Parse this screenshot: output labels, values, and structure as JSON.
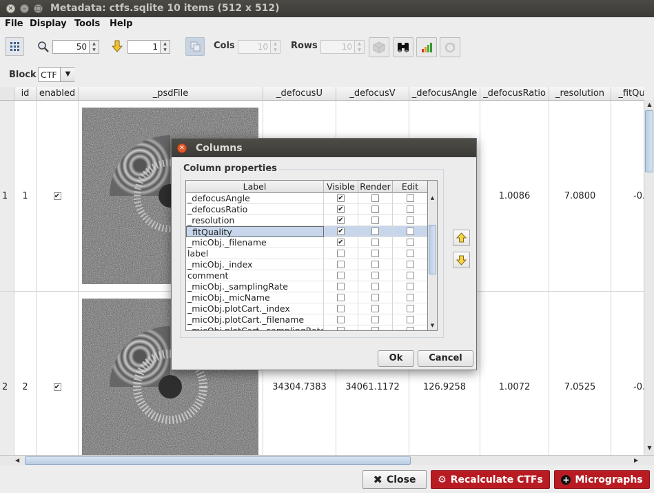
{
  "window": {
    "title": "Metadata: ctfs.sqlite 10 items (512 x 512)"
  },
  "menu": [
    "File",
    "Display",
    "Tools",
    "Help"
  ],
  "toolbar": {
    "zoom_value": "50",
    "goto_value": "1",
    "cols_label": "Cols",
    "cols_value": "10",
    "rows_label": "Rows",
    "rows_value": "10"
  },
  "block": {
    "label": "Block",
    "value": "CTF"
  },
  "table": {
    "headers": [
      "id",
      "enabled",
      "_psdFile",
      "_defocusU",
      "_defocusV",
      "_defocusAngle",
      "_defocusRatio",
      "_resolution",
      "_fitQu"
    ],
    "rows": [
      {
        "row": "1",
        "id": "1",
        "enabled": true,
        "defocusU": "",
        "defocusV": "",
        "defocusAngle": "",
        "defocusRatio": "1.0086",
        "resolution": "7.0800",
        "fitQu": "-0."
      },
      {
        "row": "2",
        "id": "2",
        "enabled": true,
        "defocusU": "34304.7383",
        "defocusV": "34061.1172",
        "defocusAngle": "126.9258",
        "defocusRatio": "1.0072",
        "resolution": "7.0525",
        "fitQu": "-0."
      }
    ]
  },
  "dialog": {
    "title": "Columns",
    "group_label": "Column properties",
    "headers": [
      "Label",
      "Visible",
      "Render",
      "Edit"
    ],
    "rows": [
      {
        "label": "_defocusAngle",
        "visible": true,
        "render": false,
        "edit": false
      },
      {
        "label": "_defocusRatio",
        "visible": true,
        "render": false,
        "edit": false
      },
      {
        "label": "_resolution",
        "visible": true,
        "render": false,
        "edit": false
      },
      {
        "label": "_fitQuality",
        "visible": true,
        "render": false,
        "edit": false,
        "selected": true
      },
      {
        "label": "_micObj._filename",
        "visible": true,
        "render": false,
        "edit": false
      },
      {
        "label": "label",
        "visible": false,
        "render": false,
        "edit": false
      },
      {
        "label": "_micObj._index",
        "visible": false,
        "render": false,
        "edit": false
      },
      {
        "label": "comment",
        "visible": false,
        "render": false,
        "edit": false
      },
      {
        "label": "_micObj._samplingRate",
        "visible": false,
        "render": false,
        "edit": false
      },
      {
        "label": "_micObj._micName",
        "visible": false,
        "render": false,
        "edit": false
      },
      {
        "label": "_micObj.plotCart._index",
        "visible": false,
        "render": false,
        "edit": false
      },
      {
        "label": "_micObj.plotCart._filename",
        "visible": false,
        "render": false,
        "edit": false
      },
      {
        "label": "_micObj.plotCart._samplingRate",
        "visible": false,
        "render": false,
        "edit": false
      }
    ],
    "ok_label": "Ok",
    "cancel_label": "Cancel"
  },
  "footer": {
    "close_label": "Close",
    "recalc_label": "Recalculate CTFs",
    "micrographs_label": "Micrographs"
  },
  "colors": {
    "accent_red": "#b81c22",
    "selection": "#c7d6ea"
  }
}
